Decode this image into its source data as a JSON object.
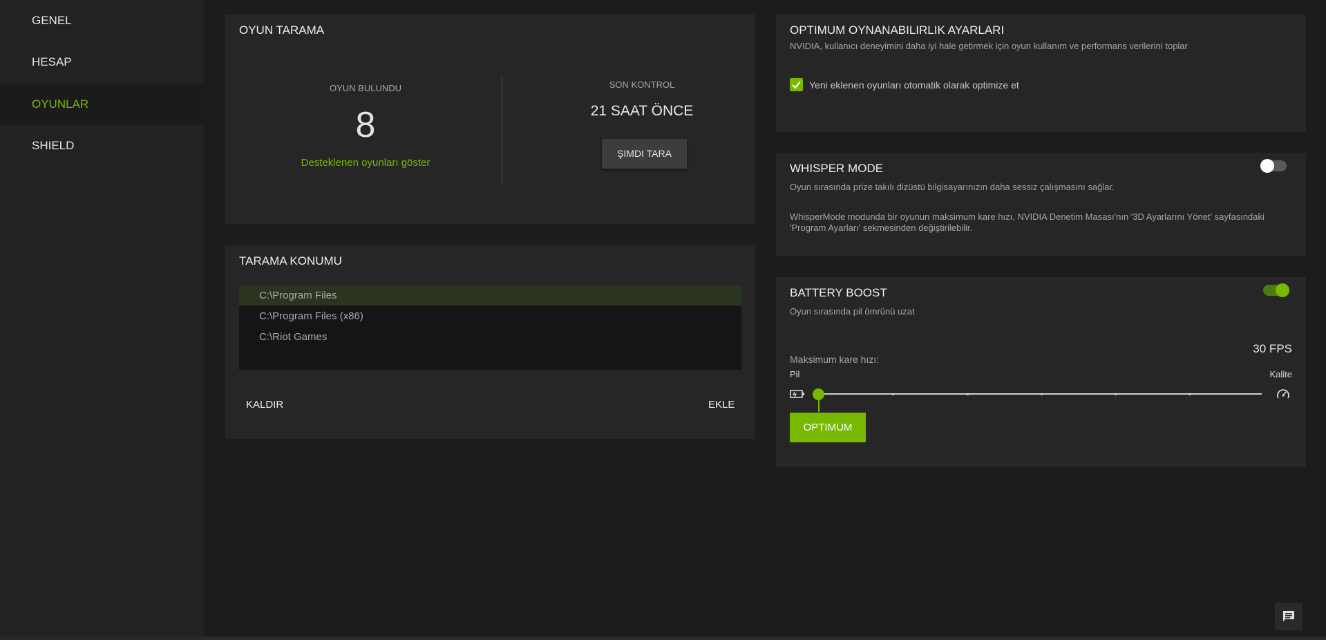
{
  "sidebar": {
    "items": [
      {
        "label": "GENEL"
      },
      {
        "label": "HESAP"
      },
      {
        "label": "OYUNLAR"
      },
      {
        "label": "SHIELD"
      }
    ],
    "active_index": 2
  },
  "game_scan": {
    "title": "OYUN TARAMA",
    "found_label": "OYUN BULUNDU",
    "found_count": "8",
    "show_supported_link": "Desteklenen oyunları göster",
    "last_check_label": "SON KONTROL",
    "last_check_value": "21 SAAT ÖNCE",
    "scan_now_button": "ŞIMDI TARA"
  },
  "scan_location": {
    "title": "TARAMA KONUMU",
    "paths": [
      "C:\\Program Files",
      "C:\\Program Files (x86)",
      "C:\\Riot Games"
    ],
    "selected_index": 0,
    "remove_button": "KALDIR",
    "add_button": "EKLE"
  },
  "optimal_settings": {
    "title": "OPTIMUM OYNANABILIRLIK AYARLARI",
    "description": "NVIDIA, kullanıcı deneyimini daha iyi hale getirmek için oyun kullanım ve performans verilerini toplar",
    "checkbox_label": "Yeni eklenen oyunları otomatik olarak optimize et",
    "checkbox_checked": true
  },
  "whisper_mode": {
    "title": "WHISPER MODE",
    "description": "Oyun sırasında prize takılı dizüstü bilgisayarınızın daha sessiz çalışmasını sağlar.",
    "note_line1": "WhisperMode modunda bir oyunun maksimum kare hızı, NVIDIA Denetim Masası'nın '3D Ayarlarını Yönet' sayfasındaki",
    "note_line2": "'Program Ayarları' sekmesinden değiştirilebilir.",
    "enabled": false
  },
  "battery_boost": {
    "title": "BATTERY BOOST",
    "description": "Oyun sırasında pil ömrünü uzat",
    "enabled": true,
    "max_fps_label": "Maksimum kare hızı:",
    "fps_value": "30 FPS",
    "left_label": "Pil",
    "right_label": "Kalite",
    "slider_position": 0,
    "slider_steps": 7,
    "optimal_button": "OPTIMUM"
  },
  "colors": {
    "accent": "#76b900",
    "panel": "#262626",
    "background": "#1c1c1c",
    "sidebar": "#222222"
  },
  "icons": [
    "checkmark-icon",
    "battery-icon",
    "speedometer-icon",
    "chat-icon"
  ]
}
